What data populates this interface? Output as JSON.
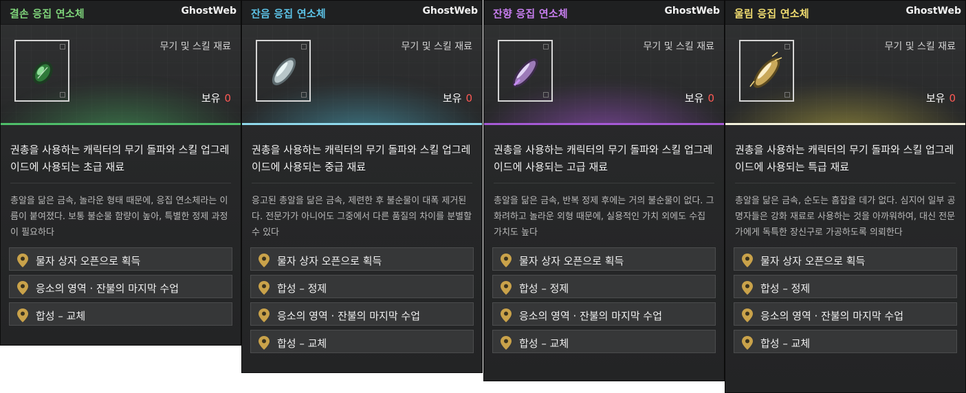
{
  "watermark": "GhostWeb",
  "cards": [
    {
      "title": "결손 응집 연소체",
      "title_color": "#7ed37a",
      "accent": "#4fbf6a",
      "category": "무기 및 스킬 재료",
      "owned_label": "보유",
      "owned_count": "0",
      "icon": "green-bullet-icon",
      "desc_main": "권총을 사용하는 캐릭터의 무기 돌파와 스킬 업그레이드에 사용되는 초급 재료",
      "desc_sub": "총알을 닮은 금속, 놀라운 형태 때문에, 응집 연소체라는 이름이 붙여졌다. 보통 불순물 함량이 높아, 특별한 정제 과정이 필요하다",
      "sources": [
        "물자 상자 오픈으로 획득",
        "응소의 영역 · 잔불의 마지막 수업",
        "합성 – 교체"
      ]
    },
    {
      "title": "잔음 응집 연소체",
      "title_color": "#5cc2e6",
      "accent": "#56c4df",
      "category": "무기 및 스킬 재료",
      "owned_label": "보유",
      "owned_count": "0",
      "icon": "blue-bullet-icon",
      "desc_main": "권총을 사용하는 캐릭터의 무기 돌파와 스킬 업그레이드에 사용되는 중급 재료",
      "desc_sub": "응고된 총알을 닮은 금속, 제련한 후 불순물이 대폭 제거된다. 전문가가 아니어도 그중에서 다른 품질의 차이를 분별할 수 있다",
      "sources": [
        "물자 상자 오픈으로 획득",
        "합성 – 정제",
        "응소의 영역 · 잔불의 마지막 수업",
        "합성 – 교체"
      ]
    },
    {
      "title": "잔향 응집 연소체",
      "title_color": "#c87ef0",
      "accent": "#b05be0",
      "category": "무기 및 스킬 재료",
      "owned_label": "보유",
      "owned_count": "0",
      "icon": "purple-bullet-icon",
      "desc_main": "권총을 사용하는 캐릭터의 무기 돌파와 스킬 업그레이드에 사용되는 고급 재료",
      "desc_sub": "총알을 닮은 금속, 반복 정제 후에는 거의 불순물이 없다. 그 화려하고 놀라운 외형 때문에, 실용적인 가치 외에도 수집 가치도 높다",
      "sources": [
        "물자 상자 오픈으로 획득",
        "합성 – 정제",
        "응소의 영역 · 잔불의 마지막 수업",
        "합성 – 교체"
      ]
    },
    {
      "title": "울림 응집 연소체",
      "title_color": "#f0dc70",
      "accent": "#d9c94a",
      "category": "무기 및 스킬 재료",
      "owned_label": "보유",
      "owned_count": "0",
      "icon": "gold-bullet-icon",
      "desc_main": "권총을 사용하는 캐릭터의 무기 돌파와 스킬 업그레이드에 사용되는 특급 재료",
      "desc_sub": "총알을 닮은 금속, 순도는 흠잡을 데가 없다. 심지어 일부 공명자들은 강화 재료로 사용하는 것을 아까워하여, 대신 전문가에게 독특한 장신구로 가공하도록 의뢰한다",
      "sources": [
        "물자 상자 오픈으로 획득",
        "합성 – 정제",
        "응소의 영역 · 잔불의 마지막 수업",
        "합성 – 교체"
      ]
    }
  ]
}
